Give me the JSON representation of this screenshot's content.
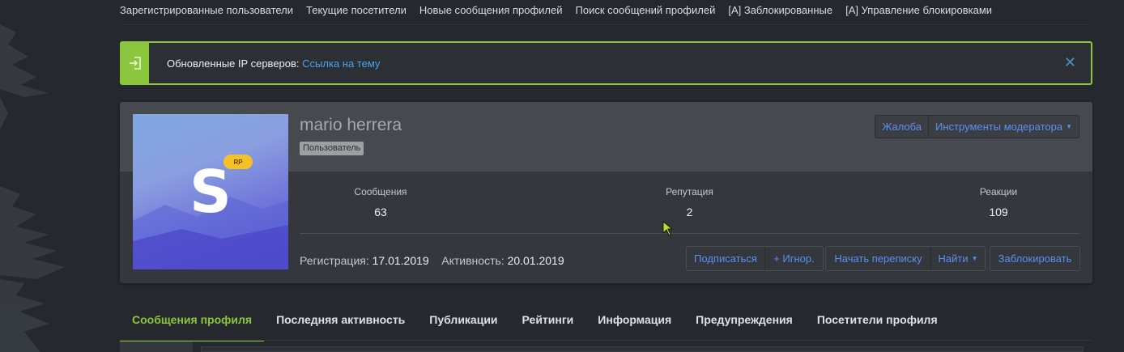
{
  "topnav": {
    "items": [
      "Зарегистрированные пользователи",
      "Текущие посетители",
      "Новые сообщения профилей",
      "Поиск сообщений профилей",
      "[A] Заблокированные",
      "[A] Управление блокировками"
    ]
  },
  "notice": {
    "text": "Обновленные IP серверов:",
    "link": "Ссылка на тему",
    "close": "✕",
    "accent": "#8cc63f"
  },
  "profile": {
    "avatar_letter": "S",
    "avatar_badge": "RP",
    "username": "mario herrera",
    "role": "Пользователь",
    "report_label": "Жалоба",
    "mod_tools_label": "Инструменты модератора",
    "stats": [
      {
        "label": "Сообщения",
        "value": "63"
      },
      {
        "label": "Репутация",
        "value": "2"
      },
      {
        "label": "Реакции",
        "value": "109"
      }
    ],
    "registered_label": "Регистрация:",
    "registered_value": "17.01.2019",
    "active_label": "Активность:",
    "active_value": "20.01.2019",
    "actions": {
      "follow": "Подписаться",
      "ignore": "+ Игнор.",
      "start_conversation": "Начать переписку",
      "find": "Найти",
      "ban": "Заблокировать"
    }
  },
  "tabs": [
    "Сообщения профиля",
    "Последняя активность",
    "Публикации",
    "Рейтинги",
    "Информация",
    "Предупреждения",
    "Посетители профиля"
  ],
  "colors": {
    "link": "#5d8ef2",
    "background": "#25282d",
    "card": "#34373c"
  }
}
